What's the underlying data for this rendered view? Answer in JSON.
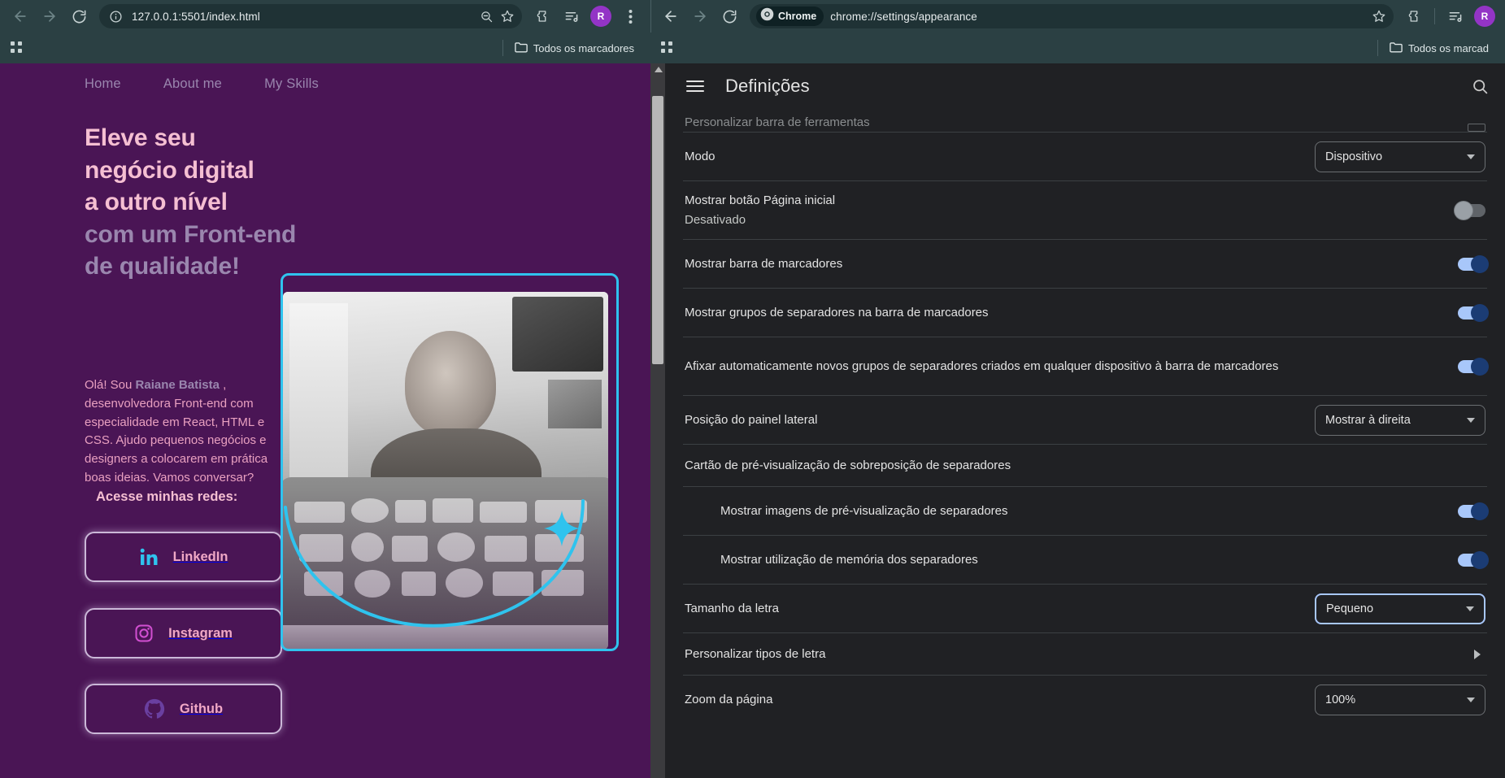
{
  "left_window": {
    "toolbar": {
      "back_icon": "arrow-left-icon",
      "forward_icon": "arrow-right-icon",
      "reload_icon": "reload-icon",
      "site_info_icon": "info-circle-icon",
      "url": "127.0.0.1:5501/index.html",
      "zoom_out_icon": "zoom-out-icon",
      "bookmark_icon": "star-icon",
      "extensions_icon": "extensions-icon",
      "reading_list_icon": "reading-list-icon",
      "profile_initial": "R",
      "menu_icon": "three-dot-menu-icon"
    },
    "bookmarks_bar": {
      "apps_icon": "apps-grid-icon",
      "all_bookmarks_label": "Todos os marcadores",
      "folder_icon": "folder-icon"
    },
    "page": {
      "nav": [
        {
          "label": "Home"
        },
        {
          "label": "About me"
        },
        {
          "label": "My Skills"
        }
      ],
      "heading": {
        "line1": "Eleve seu",
        "line2": "negócio digital",
        "line3": "a outro nível",
        "line4": "com um Front-end de qualidade!"
      },
      "intro": {
        "prefix": "Olá! Sou ",
        "name": "Raiane Batista",
        "rest": " , desenvolvedora Front-end com especialidade em React, HTML e CSS. Ajudo pequenos negócios e designers a colocarem em prática boas ideias. Vamos conversar?"
      },
      "social_heading": "Acesse minhas redes:",
      "social_buttons": [
        {
          "label": "LinkedIn",
          "icon": "linkedin-icon",
          "color": "#2fc3ee"
        },
        {
          "label": "Instagram",
          "icon": "instagram-icon",
          "color": "#d14fd1"
        },
        {
          "label": "Github",
          "icon": "github-icon",
          "color": "#6a3fa0"
        }
      ],
      "photo_alt": "portrait-photo",
      "accent_color": "#2fc3ee",
      "bg_color": "#4a1555",
      "heading_highlight_color": "#f5bfd2"
    }
  },
  "right_window": {
    "toolbar": {
      "back_icon": "arrow-left-icon",
      "forward_icon": "arrow-right-icon",
      "reload_icon": "reload-icon",
      "chrome_chip_label": "Chrome",
      "chrome_chip_icon": "chrome-logo-icon",
      "url": "chrome://settings/appearance",
      "bookmark_icon": "star-icon",
      "extensions_icon": "extensions-icon",
      "reading_list_icon": "reading-list-icon",
      "profile_initial": "R",
      "menu_icon": "three-dot-menu-icon"
    },
    "bookmarks_bar": {
      "apps_icon": "apps-grid-icon",
      "all_bookmarks_label": "Todos os marcad",
      "folder_icon": "folder-icon"
    },
    "settings": {
      "menu_icon": "hamburger-menu-icon",
      "title": "Definições",
      "search_icon": "search-icon",
      "rows": [
        {
          "label": "Personalizar barra de ferramentas",
          "control": "cutoff",
          "partial": true
        },
        {
          "label": "Modo",
          "control": "select",
          "value": "Dispositivo"
        },
        {
          "label": "Mostrar botão Página inicial",
          "sub": "Desativado",
          "control": "toggle",
          "value": "off"
        },
        {
          "label": "Mostrar barra de marcadores",
          "control": "toggle",
          "value": "on"
        },
        {
          "label": "Mostrar grupos de separadores na barra de marcadores",
          "control": "toggle",
          "value": "on"
        },
        {
          "label": "Afixar automaticamente novos grupos de separadores criados em qualquer dispositivo à barra de marcadores",
          "control": "toggle",
          "value": "on"
        },
        {
          "label": "Posição do painel lateral",
          "control": "select",
          "value": "Mostrar à direita"
        },
        {
          "label": "Cartão de pré-visualização de sobreposição de separadores",
          "control": "none"
        },
        {
          "label": "Mostrar imagens de pré-visualização de separadores",
          "control": "toggle",
          "value": "on",
          "indent": true
        },
        {
          "label": "Mostrar utilização de memória dos separadores",
          "control": "toggle",
          "value": "on",
          "indent": true
        },
        {
          "label": "Tamanho da letra",
          "control": "select",
          "value": "Pequeno",
          "focused": true
        },
        {
          "label": "Personalizar tipos de letra",
          "control": "chevron"
        },
        {
          "label": "Zoom da página",
          "control": "select",
          "value": "100%"
        }
      ]
    }
  }
}
